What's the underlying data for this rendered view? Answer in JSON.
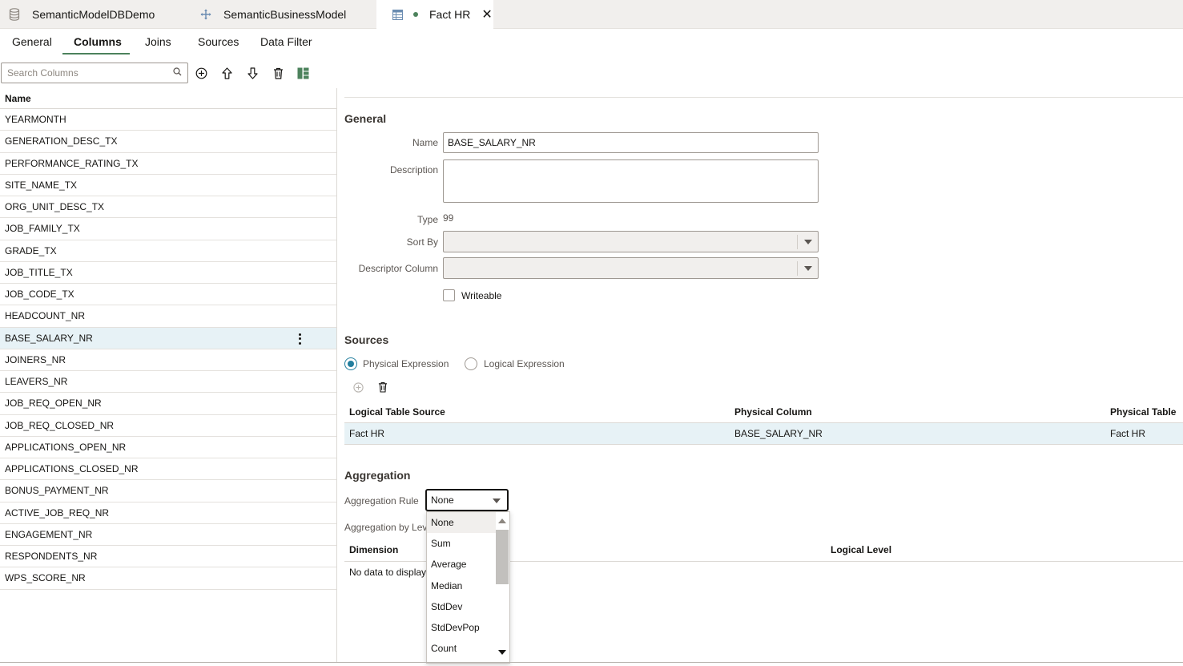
{
  "doc_tabs": [
    {
      "label": "SemanticModelDBDemo",
      "icon": "database-icon"
    },
    {
      "label": "SemanticBusinessModel",
      "icon": "move-arrows-icon"
    },
    {
      "label": "Fact HR",
      "icon": "table-icon",
      "modified": true,
      "active": true
    }
  ],
  "sub_tabs": [
    "General",
    "Columns",
    "Joins",
    "Sources",
    "Data Filter"
  ],
  "active_sub_tab": "Columns",
  "search": {
    "placeholder": "Search Columns",
    "value": ""
  },
  "toolbar": [
    "add-icon",
    "move-up-icon",
    "move-down-icon",
    "delete-icon",
    "layout-icon"
  ],
  "column_list": {
    "header": "Name",
    "rows": [
      "YEARMONTH",
      "GENERATION_DESC_TX",
      "PERFORMANCE_RATING_TX",
      "SITE_NAME_TX",
      "ORG_UNIT_DESC_TX",
      "JOB_FAMILY_TX",
      "GRADE_TX",
      "JOB_TITLE_TX",
      "JOB_CODE_TX",
      "HEADCOUNT_NR",
      "BASE_SALARY_NR",
      "JOINERS_NR",
      "LEAVERS_NR",
      "JOB_REQ_OPEN_NR",
      "JOB_REQ_CLOSED_NR",
      "APPLICATIONS_OPEN_NR",
      "APPLICATIONS_CLOSED_NR",
      "BONUS_PAYMENT_NR",
      "ACTIVE_JOB_REQ_NR",
      "ENGAGEMENT_NR",
      "RESPONDENTS_NR",
      "WPS_SCORE_NR"
    ],
    "selected": "BASE_SALARY_NR"
  },
  "general": {
    "title": "General",
    "name_label": "Name",
    "name_value": "BASE_SALARY_NR",
    "description_label": "Description",
    "description_value": "",
    "type_label": "Type",
    "type_value": "99",
    "sort_by_label": "Sort By",
    "sort_by_value": "",
    "descriptor_label": "Descriptor Column",
    "descriptor_value": "",
    "writeable_label": "Writeable",
    "writeable_checked": false
  },
  "sources": {
    "title": "Sources",
    "physical_label": "Physical Expression",
    "logical_label": "Logical Expression",
    "selected": "Physical Expression",
    "headers": [
      "Logical Table Source",
      "Physical Column",
      "Physical Table"
    ],
    "rows": [
      [
        "Fact HR",
        "BASE_SALARY_NR",
        "Fact HR"
      ]
    ]
  },
  "aggregation": {
    "title": "Aggregation",
    "rule_label": "Aggregation Rule",
    "rule_value": "None",
    "by_level_label": "Aggregation by Level",
    "headers": [
      "Dimension",
      "Logical Level"
    ],
    "empty_text": "No data to display.",
    "options": [
      "None",
      "Sum",
      "Average",
      "Median",
      "StdDev",
      "StdDevPop",
      "Count"
    ],
    "highlighted": "None"
  },
  "colors": {
    "accent_green": "#4c825c",
    "selection_blue": "#e7f2f6",
    "radio_blue": "#227e9e"
  }
}
